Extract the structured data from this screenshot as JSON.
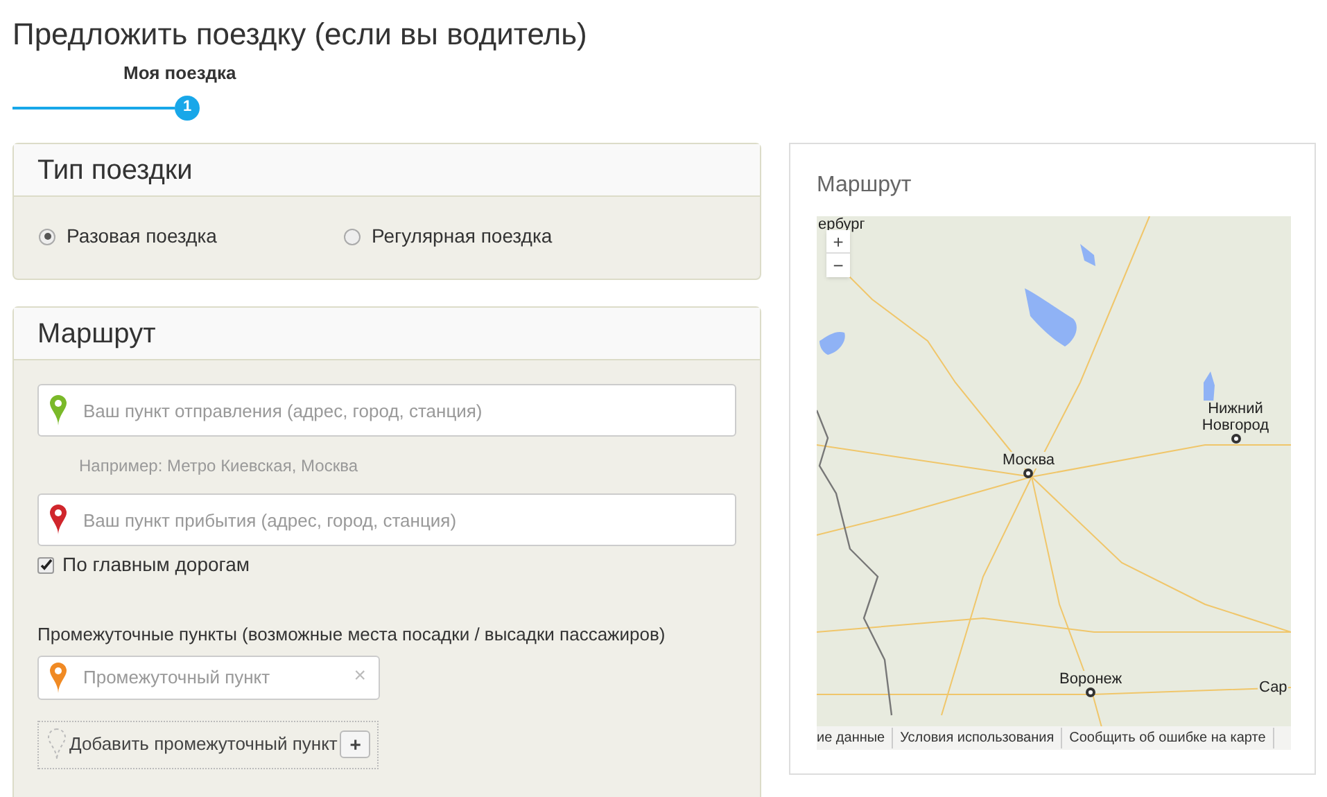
{
  "page_title": "Предложить поездку (если вы водитель)",
  "steps": [
    {
      "label": "Моя поездка",
      "number": "1",
      "selected": true
    }
  ],
  "trip_type": {
    "title": "Тип поездки",
    "options": [
      {
        "label": "Разовая поездка",
        "selected": true
      },
      {
        "label": "Регулярная поездка",
        "selected": false
      }
    ]
  },
  "route": {
    "title": "Маршрут",
    "fields": [
      {
        "placeholder": "Ваш пункт отправления (адрес, город, станция)",
        "hint": "Например: Метро Киевская, Москва",
        "color": "#7ab929"
      },
      {
        "placeholder": "Ваш пункт прибытия (адрес, город, станция)",
        "color": "#d0262c"
      }
    ],
    "main_roads": {
      "label": "По главным дорогам",
      "checked": true
    },
    "waypoints": {
      "label": "Промежуточные пункты (возможные места посадки / высадки пассажиров)",
      "items": [
        {
          "placeholder": "Промежуточный пункт",
          "clear": "×",
          "color": "#f08a24"
        }
      ],
      "add_label": "Добавить промежуточный пункт",
      "add_button": "+"
    }
  },
  "map": {
    "title": "Маршрут",
    "zoom_in": "+",
    "zoom_out": "−",
    "places": [
      {
        "name": "ербург"
      },
      {
        "name": "Москва"
      },
      {
        "name": "Нижний Новгород"
      },
      {
        "name": "Воронеж"
      },
      {
        "name": "Сар"
      }
    ],
    "footer_links": [
      "ие данные",
      "Условия использования",
      "Сообщить об ошибке на карте"
    ]
  }
}
